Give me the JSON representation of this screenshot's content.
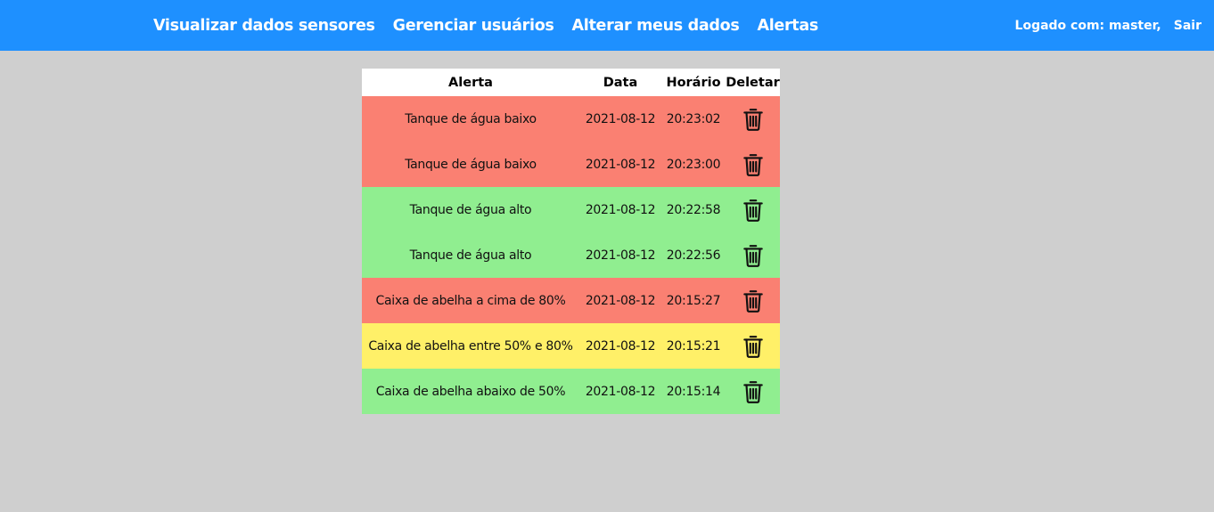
{
  "navbar": {
    "links": [
      {
        "label": "Visualizar dados sensores"
      },
      {
        "label": "Gerenciar usuários"
      },
      {
        "label": "Alterar meus dados"
      },
      {
        "label": "Alertas"
      }
    ],
    "logged_in_text": "Logado com: master,",
    "logout_label": "Sair",
    "background_color": "#1e90ff"
  },
  "table": {
    "headers": [
      "Alerta",
      "Data",
      "Horário",
      "Deletar"
    ],
    "rows": [
      {
        "alert": "Tanque de água baixo",
        "date": "2021-08-12",
        "time": "20:23:02",
        "severity": "red"
      },
      {
        "alert": "Tanque de água baixo",
        "date": "2021-08-12",
        "time": "20:23:00",
        "severity": "red"
      },
      {
        "alert": "Tanque de água alto",
        "date": "2021-08-12",
        "time": "20:22:58",
        "severity": "green"
      },
      {
        "alert": "Tanque de água alto",
        "date": "2021-08-12",
        "time": "20:22:56",
        "severity": "green"
      },
      {
        "alert": "Caixa de abelha a cima de 80%",
        "date": "2021-08-12",
        "time": "20:15:27",
        "severity": "red"
      },
      {
        "alert": "Caixa de abelha entre 50% e 80%",
        "date": "2021-08-12",
        "time": "20:15:21",
        "severity": "yellow"
      },
      {
        "alert": "Caixa de abelha abaixo de 50%",
        "date": "2021-08-12",
        "time": "20:15:14",
        "severity": "green"
      }
    ],
    "delete_icon": "trash-icon",
    "severity_colors": {
      "red": "#fa8072",
      "green": "#90ee90",
      "yellow": "#fff068"
    }
  }
}
